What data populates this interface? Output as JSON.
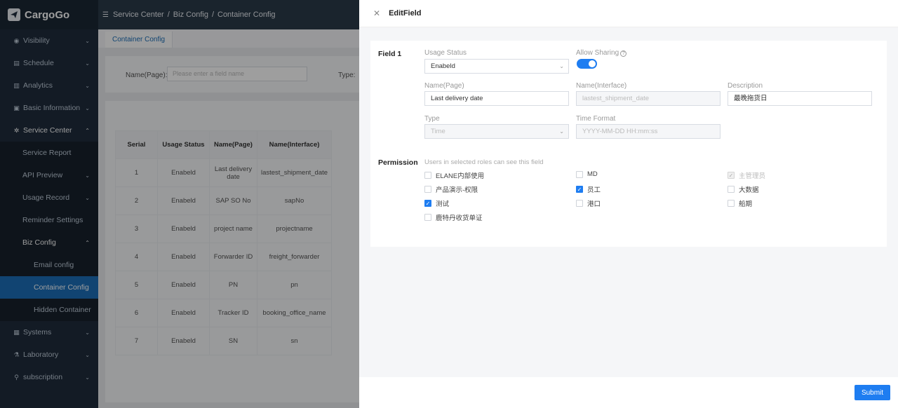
{
  "app": {
    "name": "CargoGo"
  },
  "sidebar": {
    "items": [
      {
        "label": "Visibility",
        "icon": "eye-icon"
      },
      {
        "label": "Schedule",
        "icon": "calendar-icon"
      },
      {
        "label": "Analytics",
        "icon": "chart-icon"
      },
      {
        "label": "Basic Information",
        "icon": "info-icon"
      },
      {
        "label": "Service Center",
        "icon": "gear-icon"
      }
    ],
    "service_center": {
      "items": [
        "Service Report",
        "API Preview",
        "Usage Record",
        "Reminder Settings",
        "Biz Config"
      ],
      "biz_config": [
        "Email config",
        "Container Config",
        "Hidden Container"
      ]
    },
    "bottom_items": [
      {
        "label": "Systems",
        "icon": "system-icon"
      },
      {
        "label": "Laboratory",
        "icon": "lab-icon"
      },
      {
        "label": "subscription",
        "icon": "subscription-icon"
      }
    ]
  },
  "header": {
    "breadcrumb": [
      "Service Center",
      "Biz Config",
      "Container Config"
    ]
  },
  "main": {
    "tab": "Container Config",
    "search": {
      "name_label": "Name(Page):",
      "name_placeholder": "Please enter a field name",
      "type_label": "Type:"
    },
    "table": {
      "headers": [
        "Serial",
        "Usage Status",
        "Name(Page)",
        "Name(Interface)"
      ],
      "rows": [
        [
          "1",
          "Enabeld",
          "Last delivery date",
          "lastest_shipment_date"
        ],
        [
          "2",
          "Enabeld",
          "SAP SO No",
          "sapNo"
        ],
        [
          "3",
          "Enabeld",
          "project name",
          "projectname"
        ],
        [
          "4",
          "Enabeld",
          "Forwarder ID",
          "freight_forwarder"
        ],
        [
          "5",
          "Enabeld",
          "PN",
          "pn"
        ],
        [
          "6",
          "Enabeld",
          "Tracker ID",
          "booking_office_name"
        ],
        [
          "7",
          "Enabeld",
          "SN",
          "sn"
        ]
      ]
    }
  },
  "drawer": {
    "title": "EditField",
    "field_section": "Field 1",
    "usage_status": {
      "label": "Usage Status",
      "value": "Enabeld"
    },
    "allow_sharing": {
      "label": "Allow Sharing",
      "on": true
    },
    "name_page": {
      "label": "Name(Page)",
      "value": "Last delivery date"
    },
    "name_interface": {
      "label": "Name(Interface)",
      "value": "lastest_shipment_date"
    },
    "description": {
      "label": "Description",
      "value": "最晚拖货日"
    },
    "type": {
      "label": "Type",
      "value": "Time"
    },
    "time_format": {
      "label": "Time Format",
      "placeholder": "YYYY-MM-DD HH:mm:ss"
    },
    "permission": {
      "title": "Permission",
      "hint": "Users in selected roles can see this field",
      "roles": [
        {
          "label": "ELANE内部使用",
          "checked": false
        },
        {
          "label": "MD",
          "checked": false
        },
        {
          "label": "主管理员",
          "checked": true,
          "disabled": true
        },
        {
          "label": "产品演示-权限",
          "checked": false
        },
        {
          "label": "员工",
          "checked": true
        },
        {
          "label": "大数据",
          "checked": false
        },
        {
          "label": "测试",
          "checked": true
        },
        {
          "label": "港口",
          "checked": false
        },
        {
          "label": "船期",
          "checked": false
        },
        {
          "label": "鹿特丹收货单证",
          "checked": false
        }
      ]
    },
    "submit_label": "Submit"
  }
}
